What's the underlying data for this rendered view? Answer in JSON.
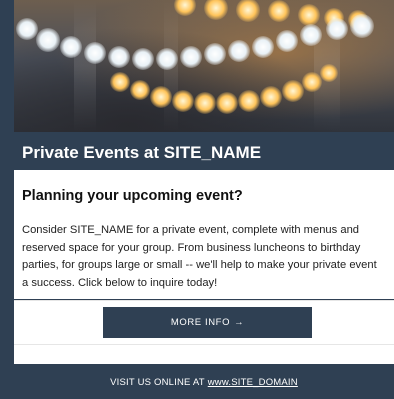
{
  "hero": {
    "image_description_icon": "string-lights-photo"
  },
  "header": {
    "title": "Private Events at SITE_NAME"
  },
  "main": {
    "heading": "Planning your upcoming event?",
    "body": "Consider SITE_NAME for a private event, complete with menus and reserved space for your group. From business luncheons to birthday parties, for groups large or small -- we'll help to make your private event a success. Click below to inquire today!"
  },
  "cta": {
    "label": "MORE INFO",
    "arrow": "→"
  },
  "footer": {
    "prefix": "VISIT US ONLINE AT",
    "link": "www.SITE_DOMAIN"
  },
  "colors": {
    "brand": "#2f4053",
    "background": "#ffffff",
    "text": "#222222"
  }
}
